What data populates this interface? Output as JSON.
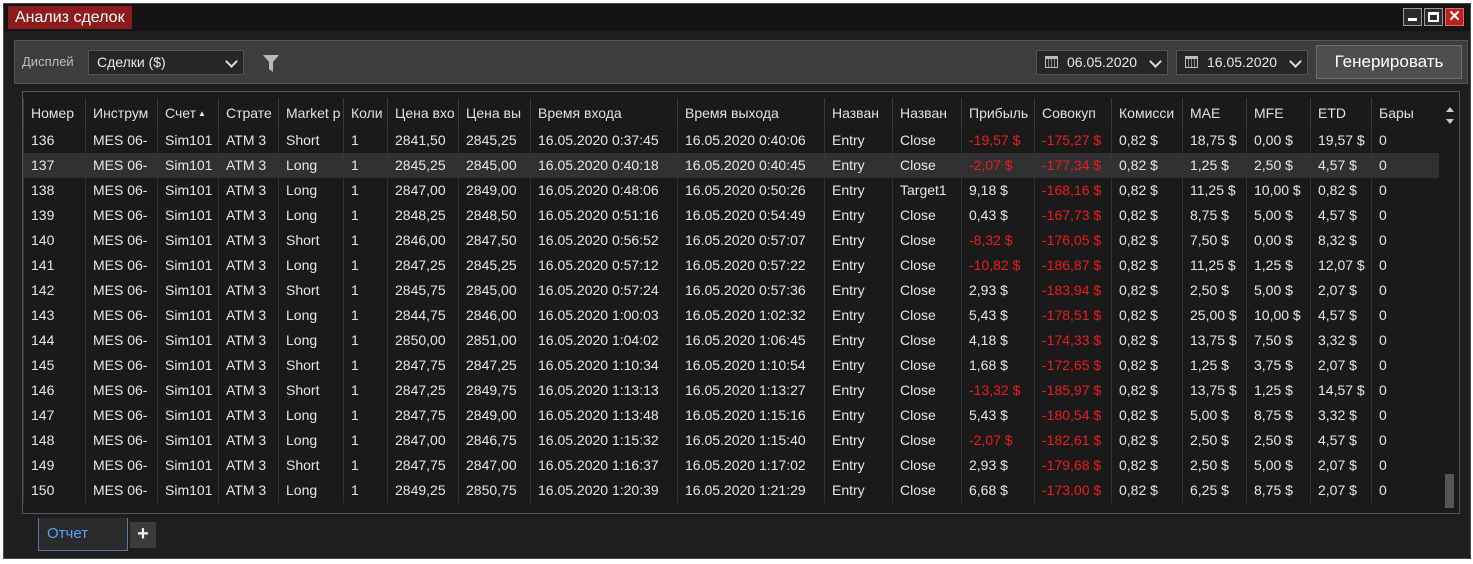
{
  "window": {
    "title": "Анализ сделок"
  },
  "toolbar": {
    "display_label": "Дисплей",
    "display_select": "Сделки ($)",
    "date_from": "06.05.2020",
    "date_to": "16.05.2020",
    "generate_label": "Генерировать"
  },
  "grid": {
    "columns": [
      "Номер",
      "Инструм",
      "Счет",
      "Страте",
      "Market p",
      "Коли",
      "Цена вхо",
      "Цена вы",
      "Время входа",
      "Время выхода",
      "Назван",
      "Назван",
      "Прибыль",
      "Совокуп",
      "Комисси",
      "MAE",
      "MFE",
      "ETD",
      "Бары"
    ],
    "sorted_column_index": 2,
    "selected_row_index": 1,
    "rows": [
      [
        "136",
        "MES 06-",
        "Sim101",
        "ATM 3",
        "Short",
        "1",
        "2841,50",
        "2845,25",
        "16.05.2020 0:37:45",
        "16.05.2020 0:40:06",
        "Entry",
        "Close",
        "-19,57 $",
        "-175,27 $",
        "0,82 $",
        "18,75 $",
        "0,00 $",
        "19,57 $",
        "0"
      ],
      [
        "137",
        "MES 06-",
        "Sim101",
        "ATM 3",
        "Long",
        "1",
        "2845,25",
        "2845,00",
        "16.05.2020 0:40:18",
        "16.05.2020 0:40:45",
        "Entry",
        "Close",
        "-2,07 $",
        "-177,34 $",
        "0,82 $",
        "1,25 $",
        "2,50 $",
        "4,57 $",
        "0"
      ],
      [
        "138",
        "MES 06-",
        "Sim101",
        "ATM 3",
        "Long",
        "1",
        "2847,00",
        "2849,00",
        "16.05.2020 0:48:06",
        "16.05.2020 0:50:26",
        "Entry",
        "Target1",
        "9,18 $",
        "-168,16 $",
        "0,82 $",
        "11,25 $",
        "10,00 $",
        "0,82 $",
        "0"
      ],
      [
        "139",
        "MES 06-",
        "Sim101",
        "ATM 3",
        "Long",
        "1",
        "2848,25",
        "2848,50",
        "16.05.2020 0:51:16",
        "16.05.2020 0:54:49",
        "Entry",
        "Close",
        "0,43 $",
        "-167,73 $",
        "0,82 $",
        "8,75 $",
        "5,00 $",
        "4,57 $",
        "0"
      ],
      [
        "140",
        "MES 06-",
        "Sim101",
        "ATM 3",
        "Short",
        "1",
        "2846,00",
        "2847,50",
        "16.05.2020 0:56:52",
        "16.05.2020 0:57:07",
        "Entry",
        "Close",
        "-8,32 $",
        "-176,05 $",
        "0,82 $",
        "7,50 $",
        "0,00 $",
        "8,32 $",
        "0"
      ],
      [
        "141",
        "MES 06-",
        "Sim101",
        "ATM 3",
        "Long",
        "1",
        "2847,25",
        "2845,25",
        "16.05.2020 0:57:12",
        "16.05.2020 0:57:22",
        "Entry",
        "Close",
        "-10,82 $",
        "-186,87 $",
        "0,82 $",
        "11,25 $",
        "1,25 $",
        "12,07 $",
        "0"
      ],
      [
        "142",
        "MES 06-",
        "Sim101",
        "ATM 3",
        "Short",
        "1",
        "2845,75",
        "2845,00",
        "16.05.2020 0:57:24",
        "16.05.2020 0:57:36",
        "Entry",
        "Close",
        "2,93 $",
        "-183,94 $",
        "0,82 $",
        "2,50 $",
        "5,00 $",
        "2,07 $",
        "0"
      ],
      [
        "143",
        "MES 06-",
        "Sim101",
        "ATM 3",
        "Long",
        "1",
        "2844,75",
        "2846,00",
        "16.05.2020 1:00:03",
        "16.05.2020 1:02:32",
        "Entry",
        "Close",
        "5,43 $",
        "-178,51 $",
        "0,82 $",
        "25,00 $",
        "10,00 $",
        "4,57 $",
        "0"
      ],
      [
        "144",
        "MES 06-",
        "Sim101",
        "ATM 3",
        "Long",
        "1",
        "2850,00",
        "2851,00",
        "16.05.2020 1:04:02",
        "16.05.2020 1:06:45",
        "Entry",
        "Close",
        "4,18 $",
        "-174,33 $",
        "0,82 $",
        "13,75 $",
        "7,50 $",
        "3,32 $",
        "0"
      ],
      [
        "145",
        "MES 06-",
        "Sim101",
        "ATM 3",
        "Short",
        "1",
        "2847,75",
        "2847,25",
        "16.05.2020 1:10:34",
        "16.05.2020 1:10:54",
        "Entry",
        "Close",
        "1,68 $",
        "-172,65 $",
        "0,82 $",
        "1,25 $",
        "3,75 $",
        "2,07 $",
        "0"
      ],
      [
        "146",
        "MES 06-",
        "Sim101",
        "ATM 3",
        "Short",
        "1",
        "2847,25",
        "2849,75",
        "16.05.2020 1:13:13",
        "16.05.2020 1:13:27",
        "Entry",
        "Close",
        "-13,32 $",
        "-185,97 $",
        "0,82 $",
        "13,75 $",
        "1,25 $",
        "14,57 $",
        "0"
      ],
      [
        "147",
        "MES 06-",
        "Sim101",
        "ATM 3",
        "Long",
        "1",
        "2847,75",
        "2849,00",
        "16.05.2020 1:13:48",
        "16.05.2020 1:15:16",
        "Entry",
        "Close",
        "5,43 $",
        "-180,54 $",
        "0,82 $",
        "5,00 $",
        "8,75 $",
        "3,32 $",
        "0"
      ],
      [
        "148",
        "MES 06-",
        "Sim101",
        "ATM 3",
        "Long",
        "1",
        "2847,00",
        "2846,75",
        "16.05.2020 1:15:32",
        "16.05.2020 1:15:40",
        "Entry",
        "Close",
        "-2,07 $",
        "-182,61 $",
        "0,82 $",
        "2,50 $",
        "2,50 $",
        "4,57 $",
        "0"
      ],
      [
        "149",
        "MES 06-",
        "Sim101",
        "ATM 3",
        "Short",
        "1",
        "2847,75",
        "2847,00",
        "16.05.2020 1:16:37",
        "16.05.2020 1:17:02",
        "Entry",
        "Close",
        "2,93 $",
        "-179,68 $",
        "0,82 $",
        "2,50 $",
        "5,00 $",
        "2,07 $",
        "0"
      ],
      [
        "150",
        "MES 06-",
        "Sim101",
        "ATM 3",
        "Long",
        "1",
        "2849,25",
        "2850,75",
        "16.05.2020 1:20:39",
        "16.05.2020 1:21:29",
        "Entry",
        "Close",
        "6,68 $",
        "-173,00 $",
        "0,82 $",
        "6,25 $",
        "8,75 $",
        "2,07 $",
        "0"
      ]
    ]
  },
  "tabs": {
    "active_label": "Отчет",
    "add_label": "+"
  },
  "colors": {
    "negative": "#ee1c1c",
    "title_bg": "#8c1c1c",
    "active_tab_text": "#4da3ff"
  }
}
